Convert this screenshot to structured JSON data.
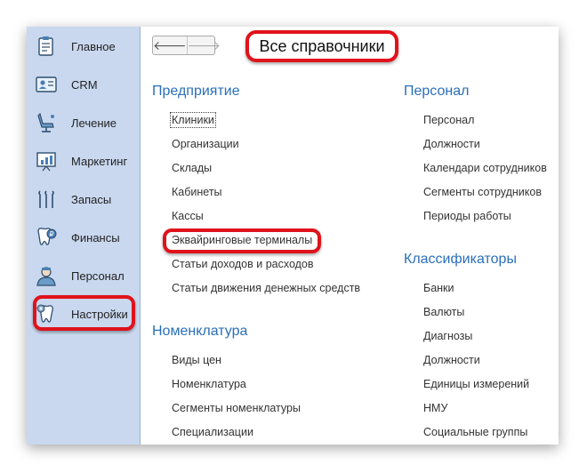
{
  "sidebar": {
    "items": [
      {
        "label": "Главное",
        "icon": "home-icon"
      },
      {
        "label": "CRM",
        "icon": "crm-icon"
      },
      {
        "label": "Лечение",
        "icon": "dental-chair-icon"
      },
      {
        "label": "Маркетинг",
        "icon": "marketing-icon"
      },
      {
        "label": "Запасы",
        "icon": "dental-tools-icon"
      },
      {
        "label": "Финансы",
        "icon": "tooth-coin-icon"
      },
      {
        "label": "Персонал",
        "icon": "doctor-icon"
      },
      {
        "label": "Настройки",
        "icon": "tooth-gear-icon"
      }
    ]
  },
  "nav": {
    "back": "🡐",
    "forward": "🡒"
  },
  "page_title": "Все справочники",
  "left_column": {
    "sections": [
      {
        "title": "Предприятие",
        "links": [
          "Клиники",
          "Организации",
          "Склады",
          "Кабинеты",
          "Кассы",
          "Эквайринговые терминалы",
          "Статьи доходов и расходов",
          "Статьи движения денежных средств"
        ]
      },
      {
        "title": "Номенклатура",
        "links": [
          "Виды цен",
          "Номенклатура",
          "Сегменты номенклатуры",
          "Специализации"
        ]
      }
    ]
  },
  "right_column": {
    "sections": [
      {
        "title": "Персонал",
        "links": [
          "Персонал",
          "Должности",
          "Календари сотрудников",
          "Сегменты сотрудников",
          "Периоды работы"
        ]
      },
      {
        "title": "Классификаторы",
        "links": [
          "Банки",
          "Валюты",
          "Диагнозы",
          "Должности",
          "Единицы измерений",
          "НМУ",
          "Социальные группы"
        ]
      }
    ]
  },
  "colors": {
    "accent": "#2a6fb8",
    "highlight": "#e0121b",
    "sidebar": "#c9d8ef"
  }
}
